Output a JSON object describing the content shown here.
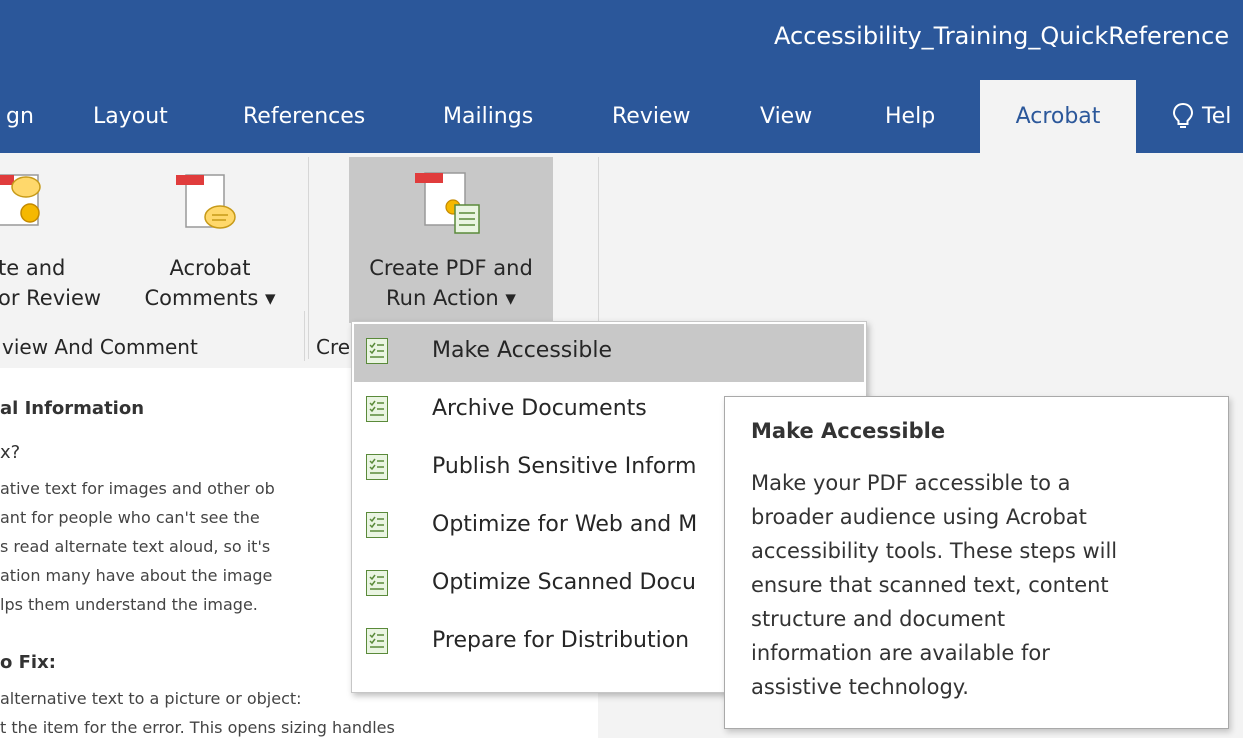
{
  "window": {
    "title": "Accessibility_Training_QuickReference"
  },
  "tabs": [
    {
      "label": "gn"
    },
    {
      "label": "Layout"
    },
    {
      "label": "References"
    },
    {
      "label": "Mailings"
    },
    {
      "label": "Review"
    },
    {
      "label": "View"
    },
    {
      "label": "Help"
    },
    {
      "label": "Acrobat",
      "active": true
    },
    {
      "label": "Tel"
    }
  ],
  "ribbon": {
    "buttons": [
      {
        "line1": "te and",
        "line2": "or Review"
      },
      {
        "line1": "Acrobat",
        "line2": "Comments ▾"
      },
      {
        "line1": "Create PDF and",
        "line2": "Run Action ▾"
      }
    ],
    "groups": [
      {
        "label": "view And Comment"
      },
      {
        "label": "Cre"
      }
    ]
  },
  "menu": {
    "items": [
      {
        "label": "Make Accessible",
        "highlighted": true
      },
      {
        "label": "Archive Documents"
      },
      {
        "label": "Publish Sensitive Inform"
      },
      {
        "label": "Optimize for Web and M"
      },
      {
        "label": "Optimize Scanned Docu"
      },
      {
        "label": "Prepare for Distribution"
      }
    ]
  },
  "tooltip": {
    "title": "Make Accessible",
    "lines": [
      "Make your PDF accessible to a",
      "broader audience using Acrobat",
      "accessibility tools. These steps will",
      "ensure that scanned text, content",
      "structure and document",
      "information are available for",
      "assistive technology."
    ]
  },
  "document": {
    "heading": "al Information",
    "subheading": "x?",
    "paragraph": [
      "ative text for images and other ob",
      "ant for people who can't see the",
      "s read alternate text aloud, so it's",
      "ation many have about the image",
      "lps them understand the image."
    ],
    "fix_heading": "o Fix:",
    "fix_lines": [
      " alternative text to a picture or object:",
      "t the item for the error. This opens sizing handles"
    ]
  },
  "colors": {
    "accent": "#2b579a",
    "ribbon_bg": "#f3f3f3",
    "hover": "#c8c8c8"
  }
}
